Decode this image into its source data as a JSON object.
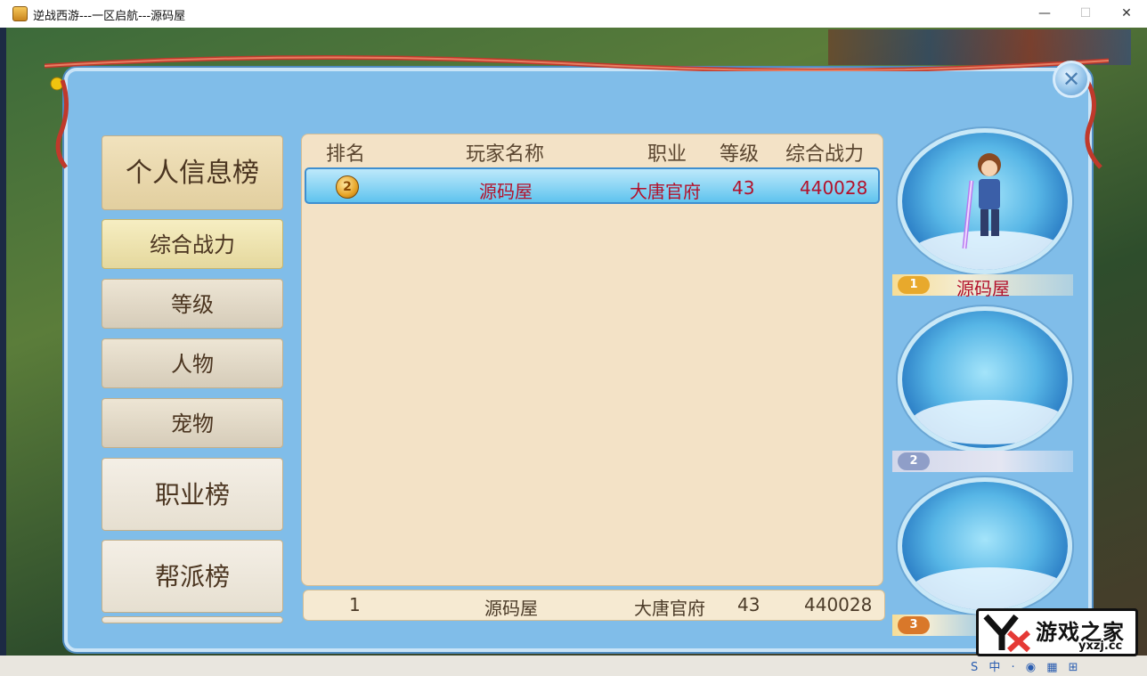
{
  "window": {
    "title": "逆战西游---一区启航---源码屋",
    "minimize": "—",
    "maximize": "☐",
    "close": "✕"
  },
  "left_tabs": {
    "main": "个人信息榜",
    "sub_tabs": [
      "综合战力",
      "等级",
      "人物",
      "宠物"
    ],
    "active_sub": "综合战力",
    "categories": [
      "职业榜",
      "帮派榜"
    ]
  },
  "table": {
    "headers": [
      "排名",
      "玩家名称",
      "职业",
      "等级",
      "综合战力"
    ],
    "rows": [
      {
        "rank": "2",
        "name": "源码屋",
        "class": "大唐官府",
        "level": "43",
        "power": "440028"
      }
    ],
    "my_row": {
      "rank": "1",
      "name": "源码屋",
      "class": "大唐官府",
      "level": "43",
      "power": "440028"
    }
  },
  "top3": [
    {
      "rank": "1",
      "name": "源码屋",
      "badge_color": "#e8a92c"
    },
    {
      "rank": "2",
      "name": "",
      "badge_color": "#8f9ec8"
    },
    {
      "rank": "3",
      "name": "",
      "badge_color": "#d9782a"
    }
  ],
  "close_button": "✕",
  "watermark_logo": {
    "title": "游戏之家",
    "url": "yxzj.cc"
  },
  "colors": {
    "panel": "#80bde9",
    "selected_row": "#5fc3ee",
    "highlight_text": "#b3112b"
  }
}
